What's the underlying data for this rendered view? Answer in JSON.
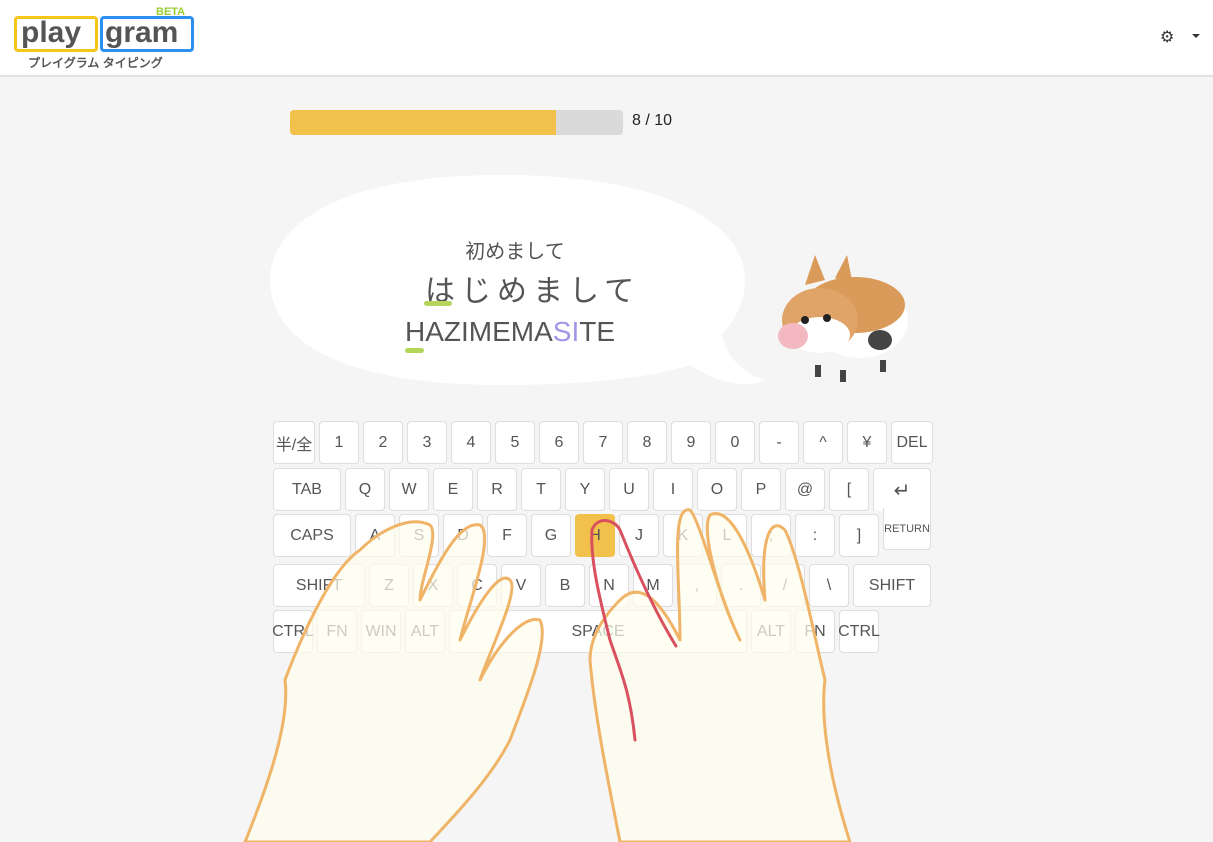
{
  "header": {
    "logo_beta": "BETA",
    "logo_play": "play",
    "logo_gram": "gram",
    "logo_sub": "プレイグラム タイピング",
    "settings_icon": "gear-icon"
  },
  "progress": {
    "current": 8,
    "total": 10,
    "label": "8 / 10",
    "color": "#f2c14b"
  },
  "prompt": {
    "kanji": "初めまして",
    "kana": "はじめまして",
    "romaji_typed": "HAZIMEMA",
    "romaji_highlight": "SI",
    "romaji_rest": "TE",
    "highlight_color": "#a494e6",
    "underline_color": "#b5d55a"
  },
  "keyboard": {
    "active_key": "H",
    "rows": [
      [
        "半/全",
        "1",
        "2",
        "3",
        "4",
        "5",
        "6",
        "7",
        "8",
        "9",
        "0",
        "-",
        "^",
        "¥",
        "DEL"
      ],
      [
        "TAB",
        "Q",
        "W",
        "E",
        "R",
        "T",
        "Y",
        "U",
        "I",
        "O",
        "P",
        "@",
        "["
      ],
      [
        "CAPS",
        "A",
        "S",
        "D",
        "F",
        "G",
        "H",
        "J",
        "K",
        "L",
        ";",
        ":",
        "]"
      ],
      [
        "SHIFT",
        "Z",
        "X",
        "C",
        "V",
        "B",
        "N",
        "M",
        ",",
        ".",
        "/",
        "\\",
        "SHIFT"
      ],
      [
        "CTRL",
        "FN",
        "WIN",
        "ALT",
        "SPACE",
        "ALT",
        "FN",
        "CTRL"
      ]
    ],
    "return_label": "RETURN",
    "enter_icon": "enter-arrow-icon"
  }
}
